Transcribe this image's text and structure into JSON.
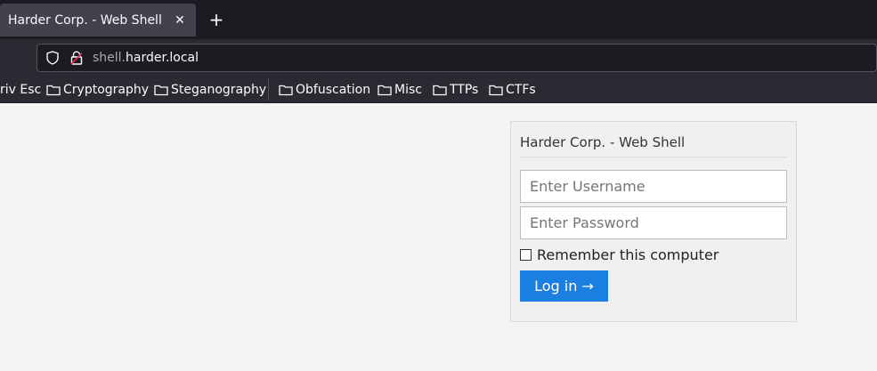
{
  "browser": {
    "tab": {
      "title": "Harder Corp. - Web Shell",
      "close_glyph": "✕"
    },
    "new_tab_glyph": "+",
    "url": {
      "subdomain": "shell.",
      "domain": "harder.local"
    },
    "icons": {
      "shield": "shield-icon",
      "lock": "insecure-lock-icon",
      "folder": "folder-icon"
    }
  },
  "bookmarks": [
    {
      "label": "riv Esc",
      "folder": false
    },
    {
      "label": "Cryptography",
      "folder": true
    },
    {
      "label": "Steganography",
      "folder": true
    },
    {
      "label": "Obfuscation",
      "folder": true
    },
    {
      "label": "Misc",
      "folder": true
    },
    {
      "label": "TTPs",
      "folder": true
    },
    {
      "label": "CTFs",
      "folder": true
    }
  ],
  "login": {
    "title": "Harder Corp. - Web Shell",
    "username_placeholder": "Enter Username",
    "username_value": "",
    "password_placeholder": "Enter Password",
    "password_value": "",
    "remember_label": "Remember this computer",
    "remember_checked": false,
    "button_label": "Log in →",
    "button_color": "#1a7fe0"
  }
}
